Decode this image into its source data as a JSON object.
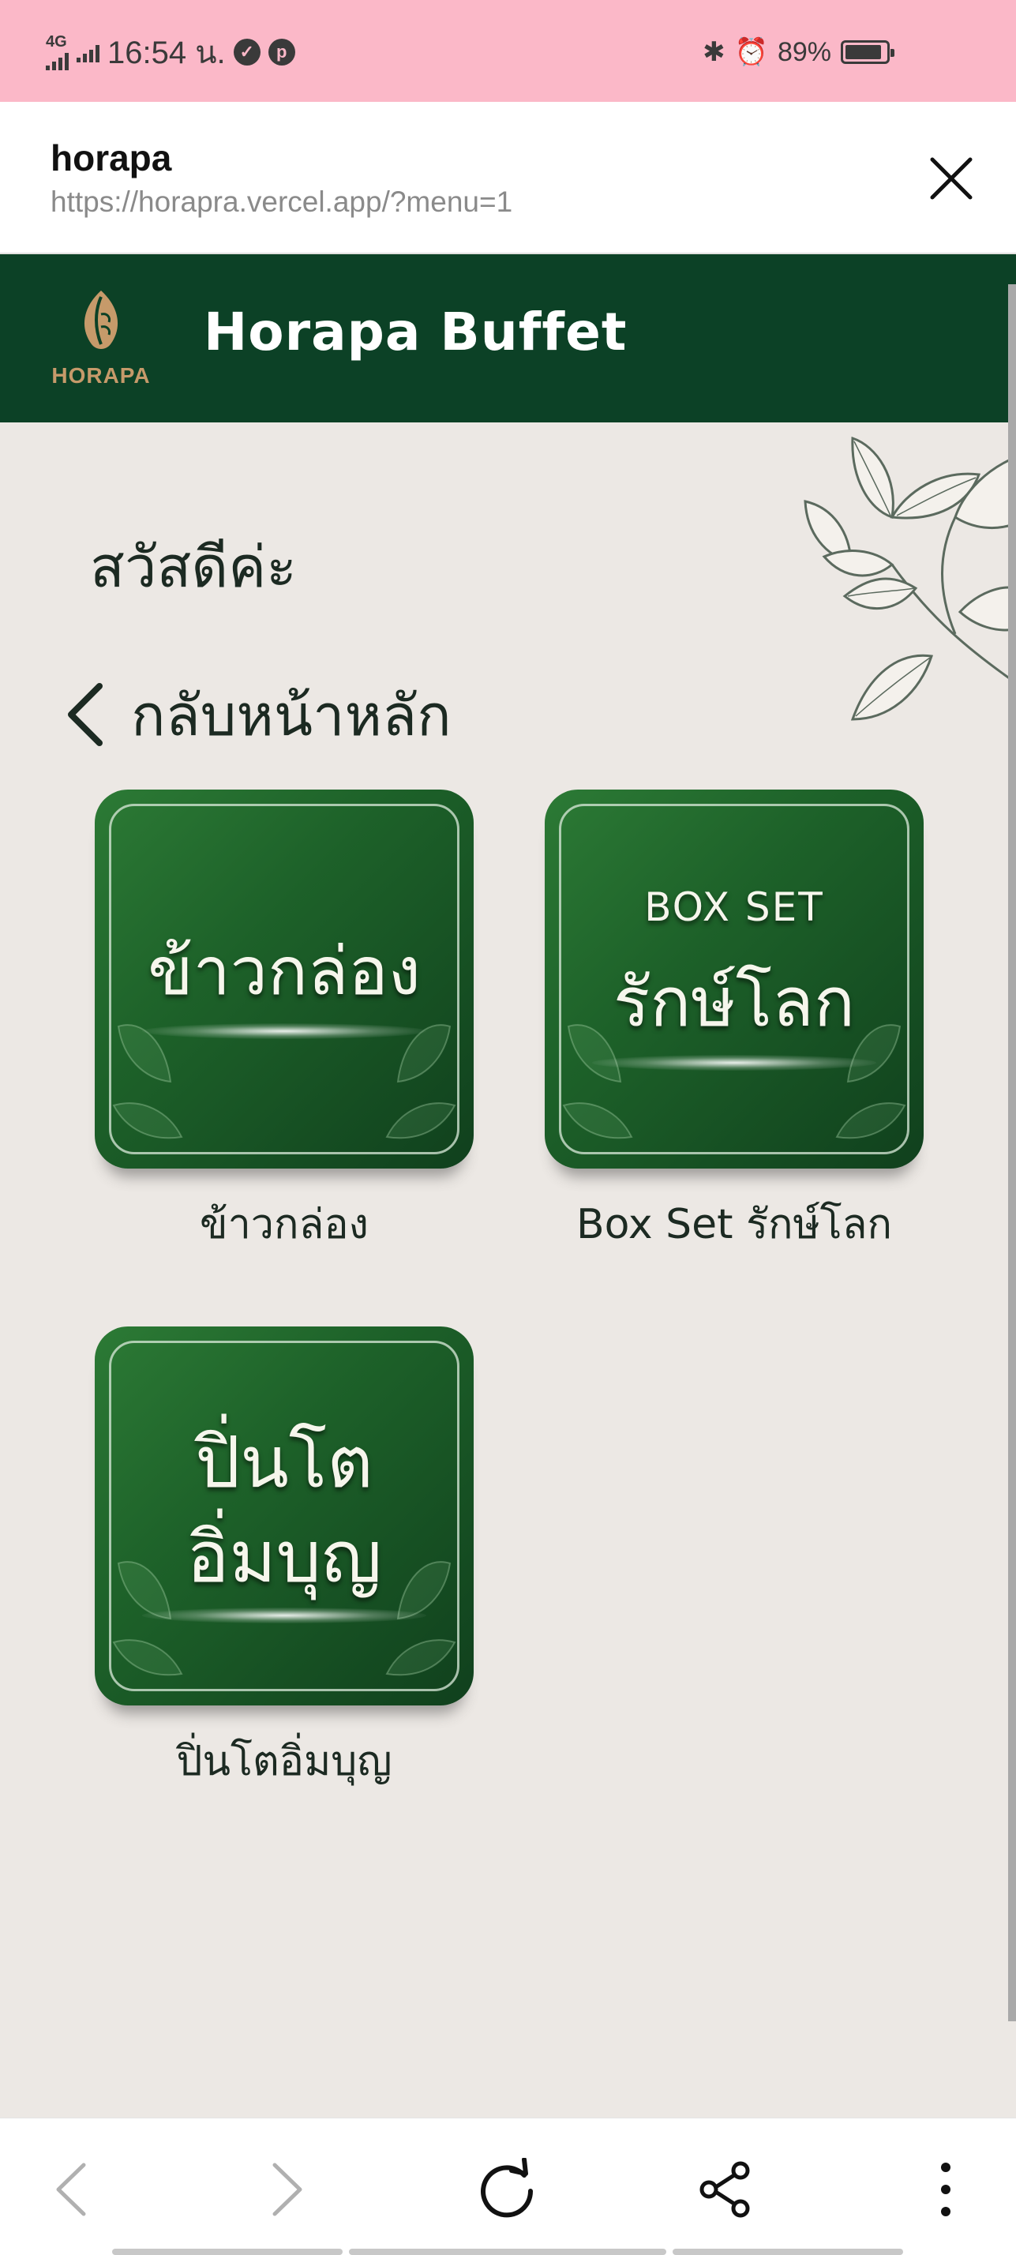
{
  "status_bar": {
    "network": "4G",
    "time": "16:54 น.",
    "battery": "89%",
    "battery_level": 0.89
  },
  "browser": {
    "page_title": "horapa",
    "url": "https://horapra.vercel.app/?menu=1"
  },
  "header": {
    "logo_text": "HORAPA",
    "title": "Horapa Buffet"
  },
  "content": {
    "greeting": "สวัสดีค่ะ",
    "back_label": "กลับหน้าหลัก",
    "menu": [
      {
        "tile_text": "ข้าวกล่อง",
        "label": "ข้าวกล่อง"
      },
      {
        "tile_small": "BOX SET",
        "tile_text": "รักษ์โลก",
        "label": "Box Set รักษ์โลก"
      },
      {
        "tile_line1": "ปิ่นโต",
        "tile_line2": "อิ่มบุญ",
        "label": "ปิ่นโตอิ่มบุญ"
      }
    ]
  },
  "colors": {
    "status_bar": "#fbb8c8",
    "header": "#0c4126",
    "background": "#ece8e4",
    "tile_green": "#1d6129"
  }
}
